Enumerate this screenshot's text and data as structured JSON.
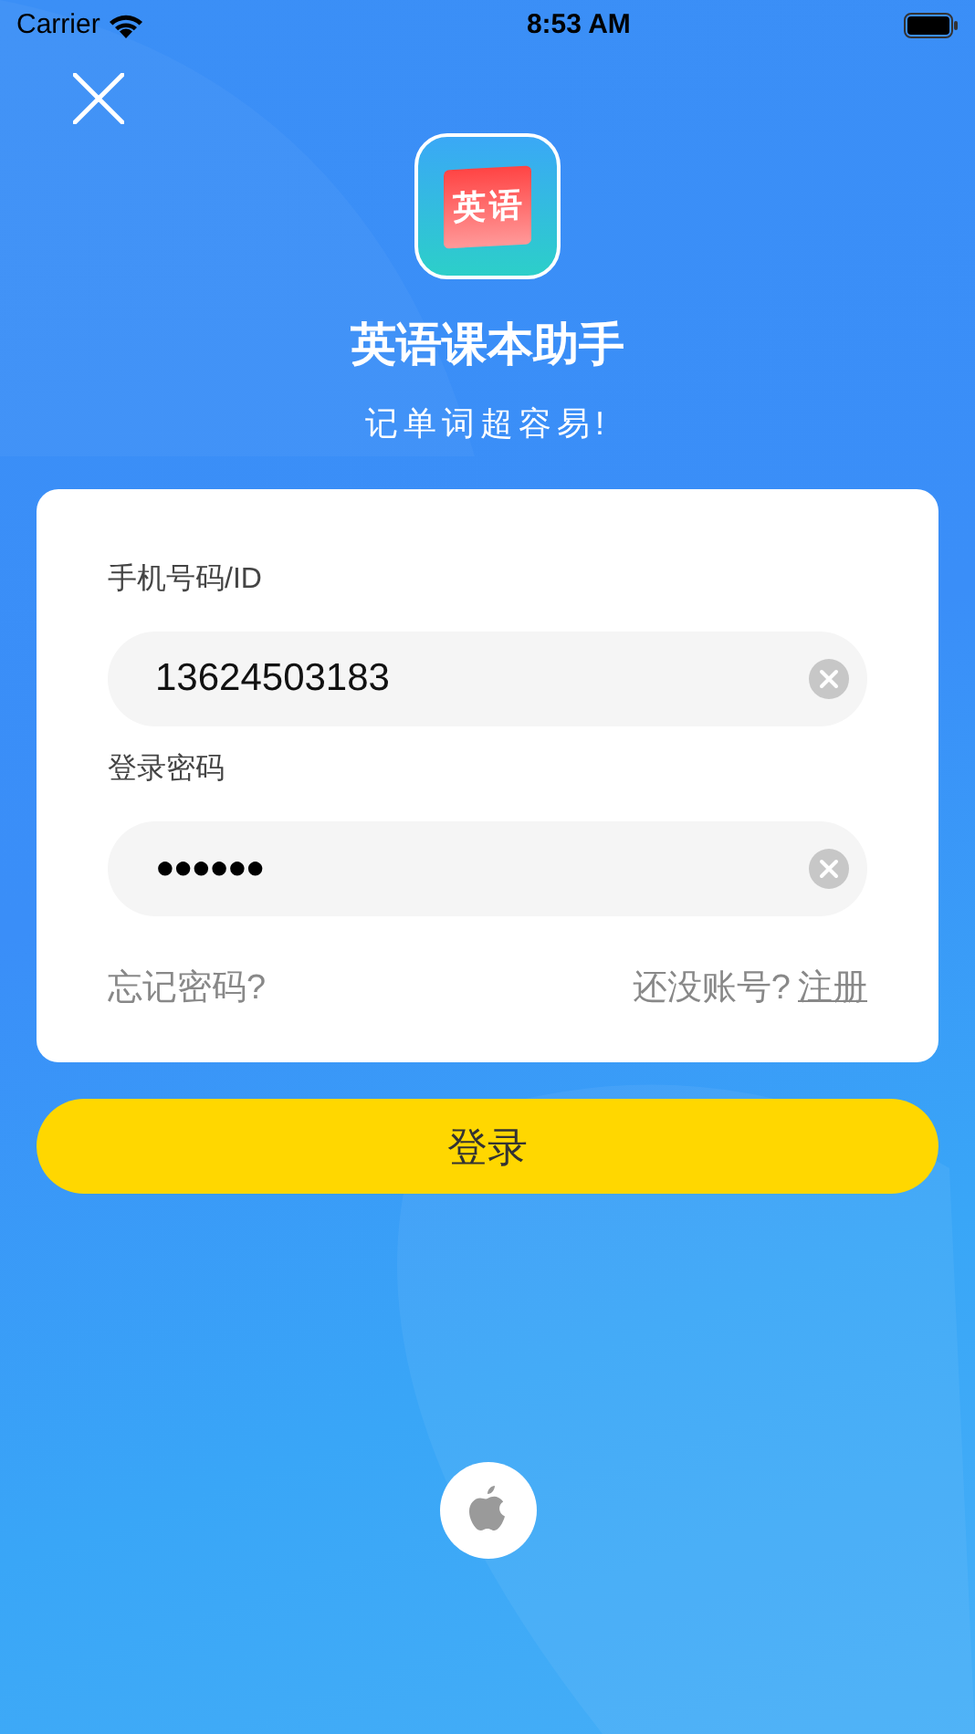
{
  "status_bar": {
    "carrier": "Carrier",
    "time": "8:53 AM"
  },
  "app": {
    "logo_text": [
      "英",
      "语"
    ],
    "title": "英语课本助手",
    "slogan": "记单词超容易!"
  },
  "form": {
    "fields": [
      {
        "label": "手机号码/ID",
        "value": "13624503183",
        "kind": "text"
      },
      {
        "label": "登录密码",
        "value": "●●●●●●",
        "kind": "password"
      }
    ],
    "forgot_link": "忘记密码?",
    "no_account": "还没账号?",
    "register_link": "注册"
  },
  "login_button": "登录"
}
